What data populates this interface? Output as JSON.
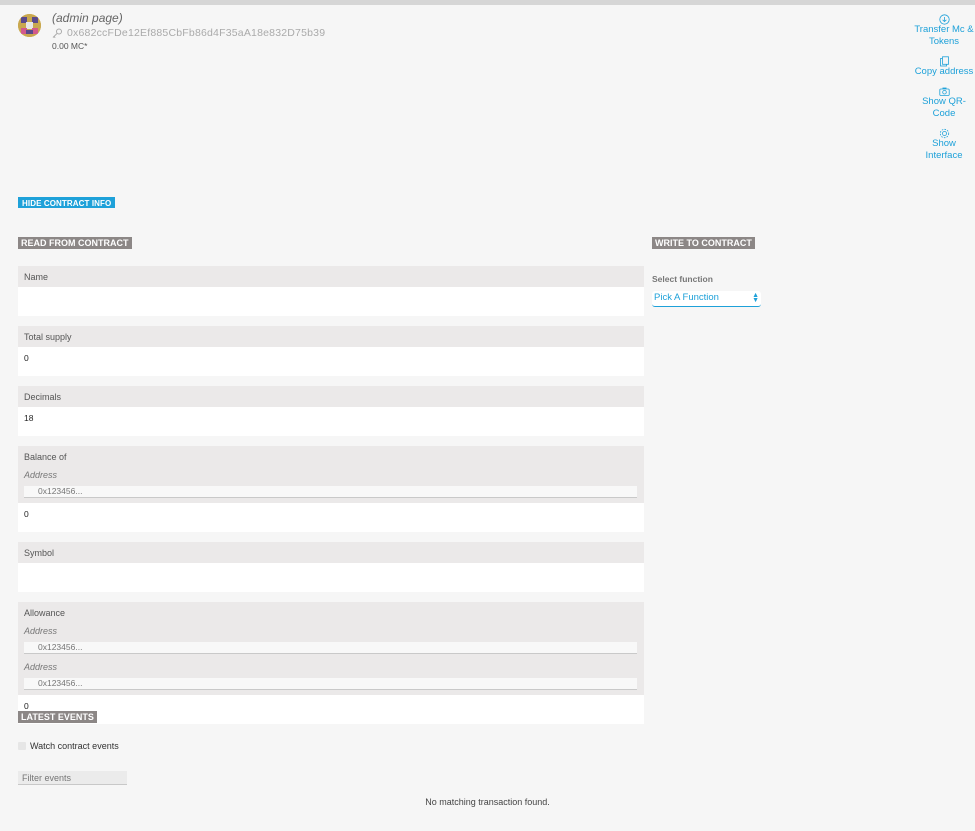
{
  "header": {
    "account_name": "(admin page)",
    "address": "0x682ccFDe12Ef885CbFb86d4F35aA18e832D75b39",
    "balance": "0.00 MC*"
  },
  "actions": [
    {
      "label": "Transfer Mc & Tokens",
      "icon": "download-circle-icon"
    },
    {
      "label": "Copy address",
      "icon": "copy-icon"
    },
    {
      "label": "Show QR-Code",
      "icon": "camera-icon"
    },
    {
      "label": "Show Interface",
      "icon": "gear-icon"
    }
  ],
  "hide_contract_info": "HIDE CONTRACT INFO",
  "read": {
    "title": "READ FROM CONTRACT",
    "rows": [
      {
        "name": "Name",
        "value": ""
      },
      {
        "name": "Total supply",
        "value": "0"
      },
      {
        "name": "Decimals",
        "value": "18"
      },
      {
        "name": "Balance of",
        "params": [
          {
            "label": "Address",
            "placeholder": "0x123456..."
          }
        ],
        "value": "0"
      },
      {
        "name": "Symbol",
        "value": ""
      },
      {
        "name": "Allowance",
        "params": [
          {
            "label": "Address",
            "placeholder": "0x123456..."
          },
          {
            "label": "Address",
            "placeholder": "0x123456..."
          }
        ],
        "value": "0"
      }
    ]
  },
  "write": {
    "title": "WRITE TO CONTRACT",
    "select_label": "Select function",
    "select_value": "Pick A Function"
  },
  "events": {
    "title": "LATEST EVENTS",
    "watch_label": "Watch contract events",
    "filter_placeholder": "Filter events",
    "empty_text": "No matching transaction found."
  },
  "colors": {
    "accent": "#1ea1d9",
    "section_title_bg": "#8c8786"
  }
}
